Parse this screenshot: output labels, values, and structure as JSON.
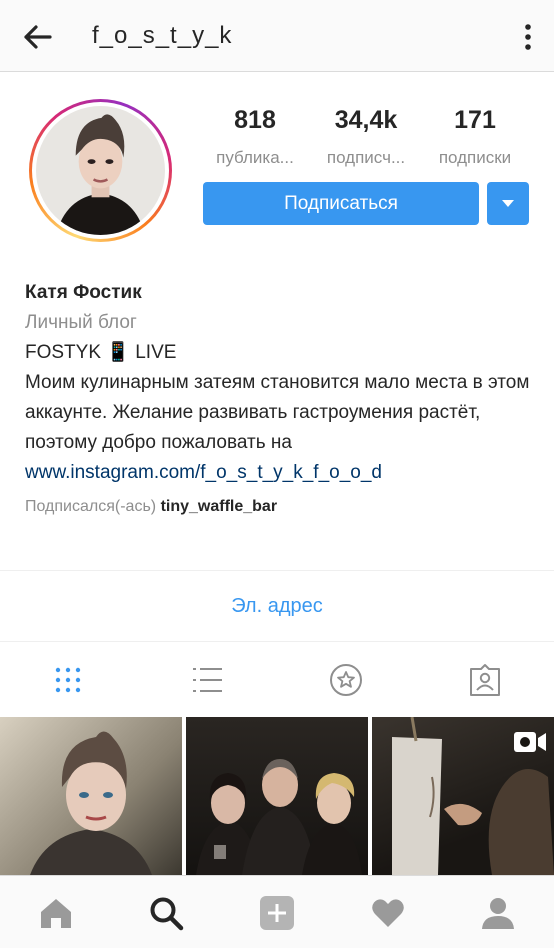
{
  "header": {
    "username": "f_o_s_t_y_k",
    "back_icon": "arrow-left-icon",
    "more_icon": "vertical-dots-icon"
  },
  "profile": {
    "stats": [
      {
        "value": "818",
        "label": "публика..."
      },
      {
        "value": "34,4k",
        "label": "подписч..."
      },
      {
        "value": "171",
        "label": "подписки"
      }
    ],
    "follow_label": "Подписаться",
    "name": "Катя Фостик",
    "category": "Личный блог",
    "bio_line1": "FOSTYK 📱 LIVE",
    "bio_text": "Моим кулинарным затеям становится мало места в этом аккаунте. Желание развивать гастроумения растёт, поэтому добро пожаловать на",
    "link": "www.instagram.com/f_o_s_t_y_k_f_o_o_d",
    "followed_prefix": "Подписался(-ась)",
    "followed_by": "tiny_waffle_bar",
    "email_label": "Эл. адрес"
  },
  "colors": {
    "accent": "#3897f0",
    "link": "#003569",
    "muted": "#8e8e8e",
    "text": "#262626"
  },
  "tabs": [
    "grid-icon",
    "list-icon",
    "star-icon",
    "tagged-icon"
  ],
  "grid": {
    "tiles": 3,
    "video_badge_icon": "video-camera-icon"
  },
  "bottom_nav": [
    "home-icon",
    "search-icon",
    "add-icon",
    "heart-icon",
    "profile-icon"
  ]
}
